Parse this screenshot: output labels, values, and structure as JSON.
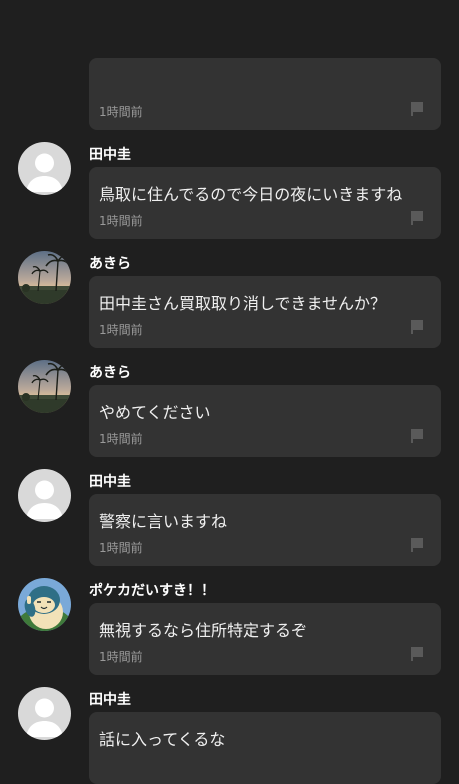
{
  "messages": [
    {
      "avatar": "default-avatar",
      "name": "",
      "text": "",
      "time": "1時間前"
    },
    {
      "avatar": "default-avatar",
      "name": "田中圭",
      "text": "鳥取に住んでるので今日の夜にいきますね",
      "time": "1時間前"
    },
    {
      "avatar": "palm-sunset-avatar",
      "name": "あきら",
      "text": "田中圭さん買取取り消しできませんか？",
      "time": "1時間前"
    },
    {
      "avatar": "palm-sunset-avatar",
      "name": "あきら",
      "text": "やめてください",
      "time": "1時間前"
    },
    {
      "avatar": "default-avatar",
      "name": "田中圭",
      "text": "警察に言いますね",
      "time": "1時間前"
    },
    {
      "avatar": "snorlax-avatar",
      "name": "ポケカだいすき！！",
      "text": "無視するなら住所特定するぞ",
      "time": "1時間前"
    },
    {
      "avatar": "default-avatar",
      "name": "田中圭",
      "text": "話に入ってくるな",
      "time": ""
    }
  ],
  "colors": {
    "background": "#1f1f1f",
    "bubble": "#333333",
    "timestamp": "#9a9a9a",
    "flag": "#5a5a5a"
  }
}
